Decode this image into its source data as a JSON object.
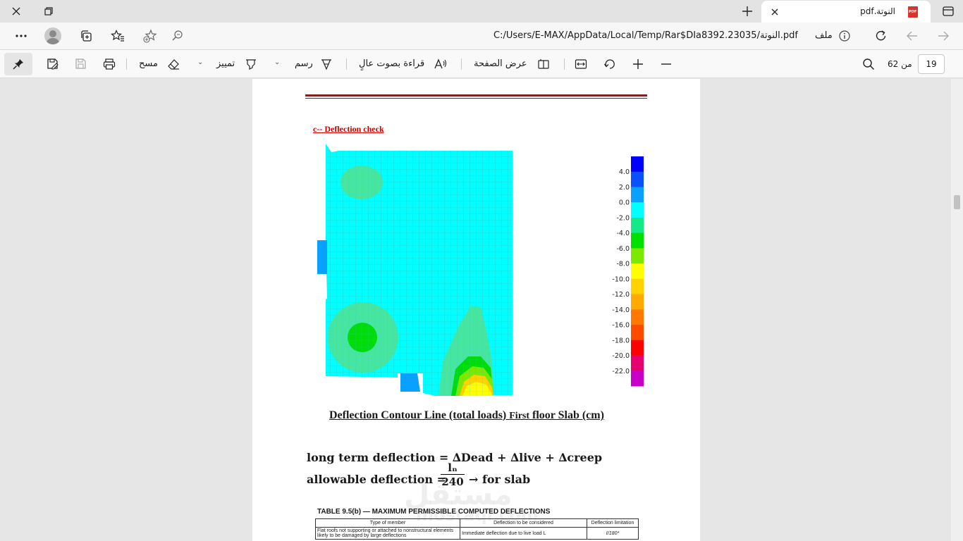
{
  "tab": {
    "title": "النوتة.pdf",
    "icon": "pdf-file-icon"
  },
  "address": {
    "url": "C:/Users/E-MAX/AppData/Local/Temp/Rar$DIa8392.23035/النوتة.pdf",
    "file_label": "ملف"
  },
  "toolbar": {
    "erase_label": "مسح",
    "highlight_label": "تمييز",
    "draw_label": "رسم",
    "read_aloud_label": "قراءة بصوت عالٍ",
    "page_view_label": "عرض الصفحة",
    "current_page": "19",
    "page_count_label": "من 62"
  },
  "document": {
    "section_title": "c-- Deflection check",
    "legend_values": [
      "4.0",
      "2.0",
      "0.0",
      "-2.0",
      "-4.0",
      "-6.0",
      "-8.0",
      "-10.0",
      "-12.0",
      "-14.0",
      "-16.0",
      "-18.0",
      "-20.0",
      "-22.0"
    ],
    "legend_colors": [
      "#0000ff",
      "#0a50ff",
      "#0aa0ff",
      "#00ffff",
      "#14e887",
      "#00e000",
      "#7de800",
      "#ffff00",
      "#ffd200",
      "#ffaa00",
      "#ff7800",
      "#ff4b00",
      "#ff0000",
      "#e6006e",
      "#c800c8"
    ],
    "caption_part1": "Deflection Contour Line (total loads) ",
    "caption_part2": "First",
    "caption_part3": " floor Slab (cm)",
    "eq1": "long term deflection = ∆Dead + ∆live + ∆creep",
    "eq2": "allowable deflection =",
    "frac_num": "lₙ",
    "frac_den": "240",
    "eq3": "→ for slab",
    "table_title": "TABLE 9.5(b) — MAXIMUM PERMISSIBLE COMPUTED DEFLECTIONS",
    "table_headers": [
      "Type of member",
      "Deflection to be considered",
      "Deflection limitation"
    ],
    "table_row1": [
      "Flat roofs not supporting or attached to nonstructural elements likely to be damaged by large deflections",
      "Immediate deflection due to live load L",
      "ℓ/180*"
    ],
    "watermark": "مستقل",
    "watermark_sub": "mostaql.com"
  }
}
